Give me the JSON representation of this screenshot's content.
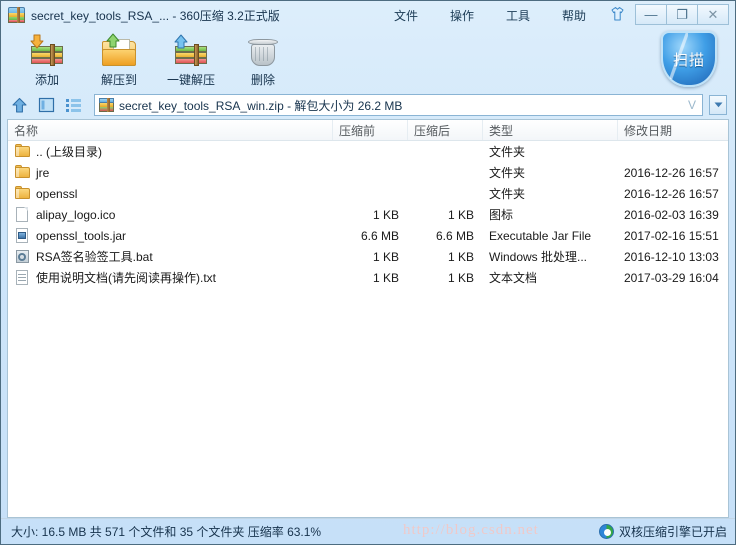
{
  "window": {
    "title": "secret_key_tools_RSA_... - 360压缩 3.2正式版",
    "app_icon": "zip-archive-icon",
    "controls": {
      "skin_label": "skin-shirt-icon",
      "minimize": "—",
      "maximize": "❐",
      "close": "✕"
    }
  },
  "menubar": {
    "items": [
      {
        "label": "文件",
        "name": "menu-file"
      },
      {
        "label": "操作",
        "name": "menu-action"
      },
      {
        "label": "工具",
        "name": "menu-tools"
      },
      {
        "label": "帮助",
        "name": "menu-help"
      }
    ]
  },
  "toolbar": {
    "buttons": [
      {
        "label": "添加",
        "icon": "add-to-archive-icon"
      },
      {
        "label": "解压到",
        "icon": "extract-to-folder-icon"
      },
      {
        "label": "一键解压",
        "icon": "one-click-extract-icon"
      },
      {
        "label": "删除",
        "icon": "delete-trash-icon"
      }
    ],
    "scan_button": {
      "label": "扫描",
      "icon": "shield-scan-icon"
    }
  },
  "addressbar": {
    "nav": [
      {
        "name": "up-directory-icon"
      },
      {
        "name": "view-panel-icon"
      },
      {
        "name": "view-list-icon"
      }
    ],
    "archive_icon": "zip-archive-icon",
    "path_text": "secret_key_tools_RSA_win.zip - 解包大小为 26.2 MB",
    "v_marker": "V",
    "dropdown_icon": "▼"
  },
  "filelist": {
    "columns": [
      {
        "label": "名称"
      },
      {
        "label": "压缩前"
      },
      {
        "label": "压缩后"
      },
      {
        "label": "类型"
      },
      {
        "label": "修改日期"
      }
    ],
    "rows": [
      {
        "icon": "folder-icon",
        "name": ".. (上级目录)",
        "before": "",
        "after": "",
        "type": "文件夹",
        "date": ""
      },
      {
        "icon": "folder-icon",
        "name": "jre",
        "before": "",
        "after": "",
        "type": "文件夹",
        "date": "2016-12-26 16:57"
      },
      {
        "icon": "folder-icon",
        "name": "openssl",
        "before": "",
        "after": "",
        "type": "文件夹",
        "date": "2016-12-26 16:57"
      },
      {
        "icon": "ico-file-icon",
        "name": "alipay_logo.ico",
        "before": "1 KB",
        "after": "1 KB",
        "type": "图标",
        "date": "2016-02-03 16:39"
      },
      {
        "icon": "jar-file-icon",
        "name": "openssl_tools.jar",
        "before": "6.6 MB",
        "after": "6.6 MB",
        "type": "Executable Jar File",
        "date": "2017-02-16 15:51"
      },
      {
        "icon": "bat-file-icon",
        "name": "RSA签名验签工具.bat",
        "before": "1 KB",
        "after": "1 KB",
        "type": "Windows 批处理...",
        "date": "2016-12-10 13:03"
      },
      {
        "icon": "txt-file-icon",
        "name": "使用说明文档(请先阅读再操作).txt",
        "before": "1 KB",
        "after": "1 KB",
        "type": "文本文档",
        "date": "2017-03-29 16:04"
      }
    ]
  },
  "statusbar": {
    "summary": "大小: 16.5 MB 共 571 个文件和 35 个文件夹 压缩率 63.1%",
    "engine_label": "双核压缩引擎已开启",
    "engine_icon": "dual-core-engine-icon",
    "watermark": "http://blog.csdn.net"
  }
}
